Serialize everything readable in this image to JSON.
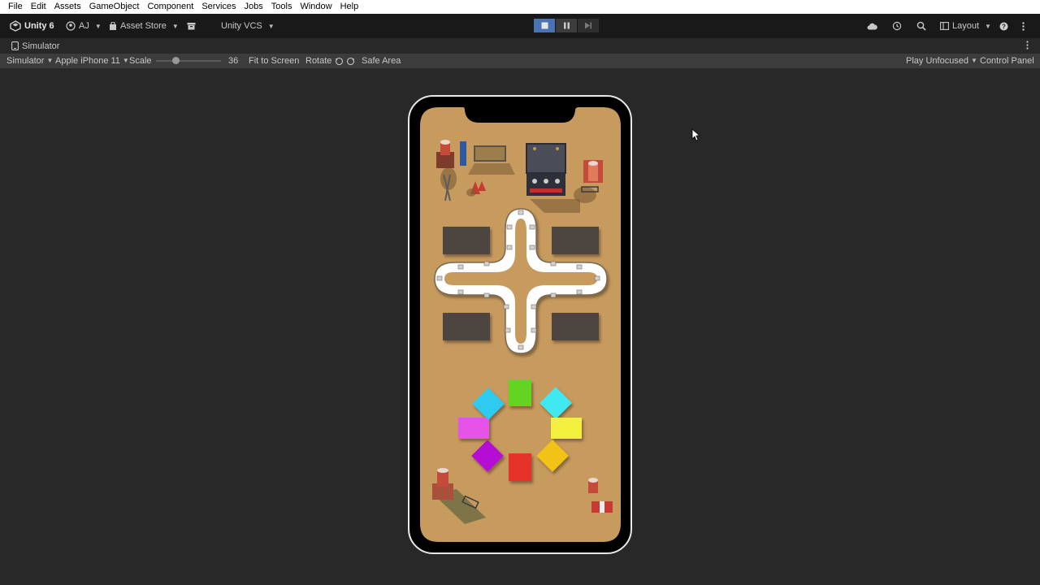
{
  "menu": [
    "File",
    "Edit",
    "Assets",
    "GameObject",
    "Component",
    "Services",
    "Jobs",
    "Tools",
    "Window",
    "Help"
  ],
  "toolbar": {
    "app_name": "Unity 6",
    "account": "AJ",
    "asset_store": "Asset Store",
    "vcs": "Unity VCS",
    "layout": "Layout"
  },
  "tab": {
    "label": "Simulator"
  },
  "simulator": {
    "mode": "Simulator",
    "device": "Apple iPhone 11",
    "scale_label": "Scale",
    "scale_value": "36",
    "fit": "Fit to Screen",
    "rotate": "Rotate",
    "safe_area": "Safe Area",
    "play_focus": "Play Unfocused",
    "control_panel": "Control Panel"
  },
  "game": {
    "tile_colors": [
      "#63d420",
      "#3fe9f2",
      "#f2ef3c",
      "#f0c318",
      "#e5312c",
      "#b40fd4",
      "#e552e8",
      "#2fcaf0"
    ]
  }
}
